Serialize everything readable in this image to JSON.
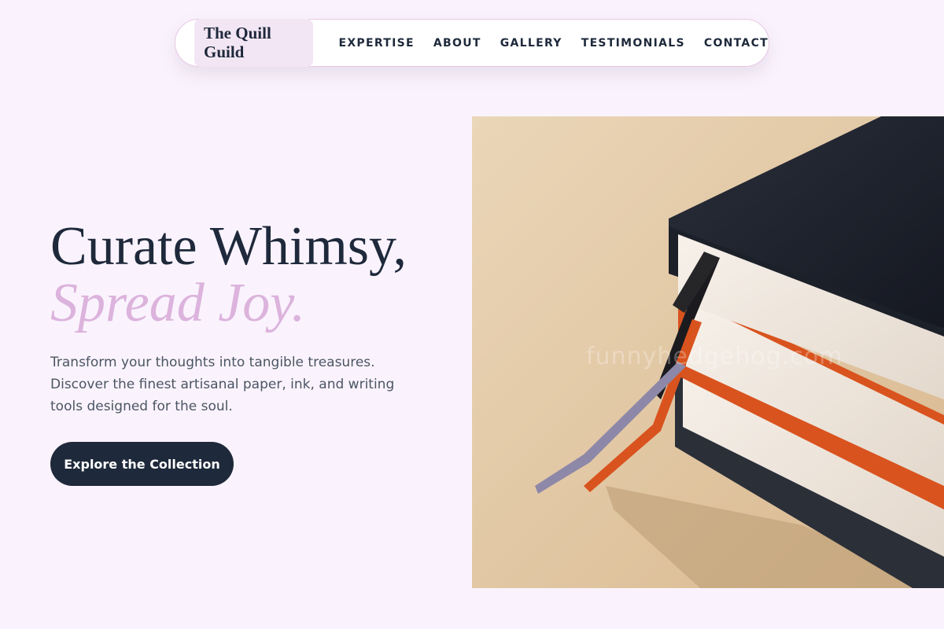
{
  "nav": {
    "brand": "The Quill Guild",
    "links": [
      {
        "label": "EXPERTISE"
      },
      {
        "label": "ABOUT"
      },
      {
        "label": "GALLERY"
      },
      {
        "label": "TESTIMONIALS"
      },
      {
        "label": "CONTACT"
      }
    ]
  },
  "hero": {
    "title_line1": "Curate Whimsy,",
    "title_line2": "Spread Joy.",
    "subtitle": "Transform your thoughts into tangible treasures. Discover the finest artisanal paper, ink, and writing tools designed for the soul.",
    "cta_label": "Explore the Collection",
    "image": {
      "watermark": "funnyhedgehog.com"
    }
  },
  "colors": {
    "background": "#faf3fd",
    "ink": "#1e293b",
    "accent": "#dcb3dd",
    "brand_chip": "#f3e6f4"
  }
}
